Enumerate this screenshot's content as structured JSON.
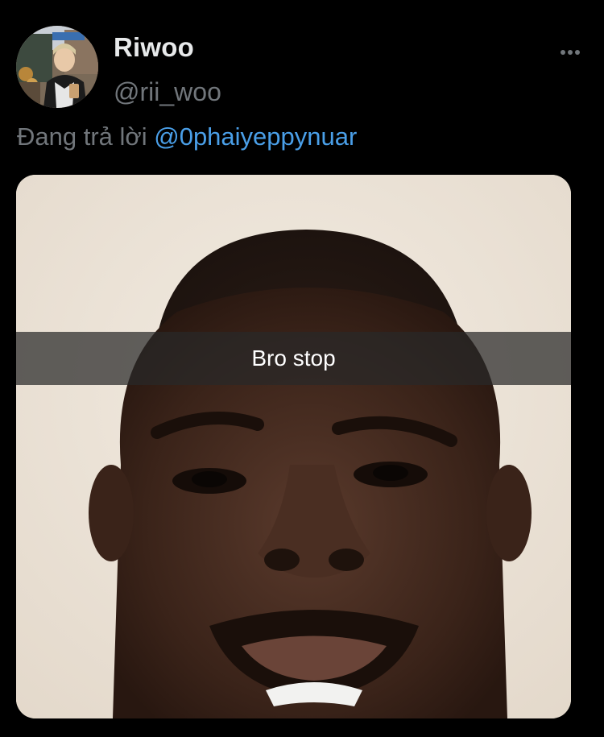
{
  "tweet": {
    "author": {
      "display_name": "Riwoo",
      "handle": "@rii_woo",
      "avatar_icon": "profile-photo"
    },
    "reply": {
      "prefix": "Đang trả lời ",
      "mention": "@0phaiyeppynuar"
    },
    "media": {
      "caption": "Bro stop"
    },
    "more_icon": "more-horizontal-icon"
  },
  "colors": {
    "background": "#000000",
    "primary_text": "#e7e9ea",
    "secondary_text": "#71767b",
    "link": "#4a9fe8"
  }
}
